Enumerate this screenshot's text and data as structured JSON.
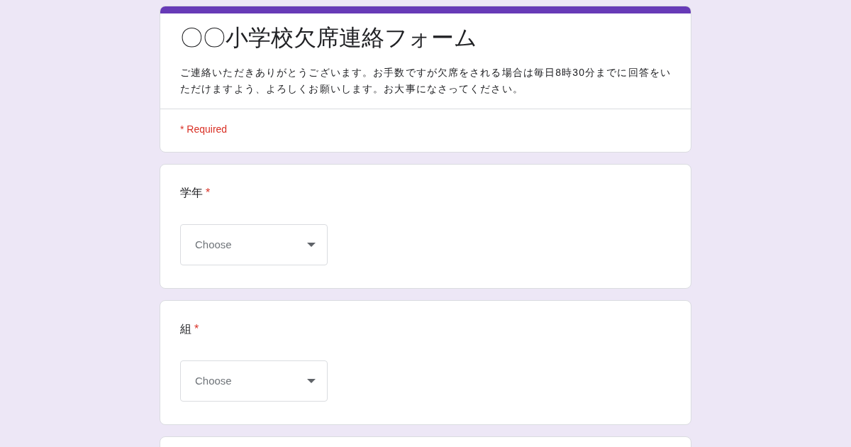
{
  "header": {
    "title": "〇〇小学校欠席連絡フォーム",
    "description": "ご連絡いただきありがとうございます。お手数ですが欠席をされる場合は毎日8時30分までに回答をいただけますよう、よろしくお願いします。お大事になさってください。",
    "required_note": "* Required"
  },
  "questions": [
    {
      "label": "学年",
      "required_mark": "*",
      "kind": "dropdown",
      "placeholder": "Choose"
    },
    {
      "label": "組",
      "required_mark": "*",
      "kind": "dropdown",
      "placeholder": "Choose"
    }
  ]
}
